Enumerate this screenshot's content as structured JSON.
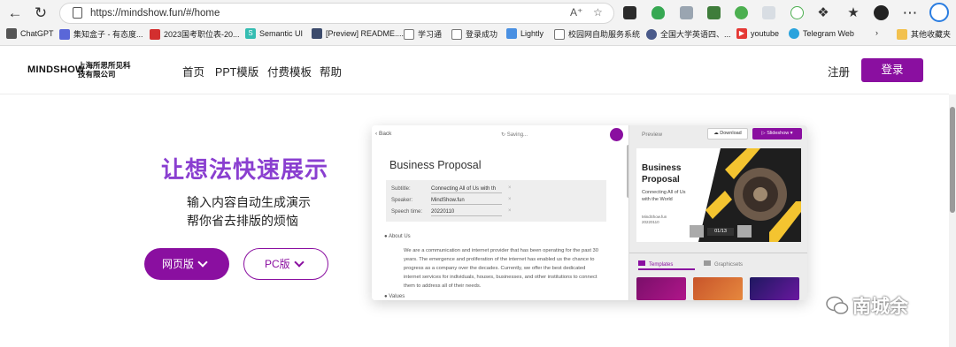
{
  "browser": {
    "url": "https://mindshow.fun/#/home",
    "bookmarks": [
      {
        "label": "ChatGPT",
        "icon": "chatgpt-icon",
        "color": "#555555"
      },
      {
        "label": "集知盒子 - 有态度...",
        "icon": "puzzle-icon",
        "color": "#5a67d8"
      },
      {
        "label": "2023国考职位表-20...",
        "icon": "pdf-icon",
        "color": "#d32f2f"
      },
      {
        "label": "Semantic UI",
        "icon": "semantic-icon",
        "color": "#35bdb2"
      },
      {
        "label": "[Preview] README....",
        "icon": "github-icon",
        "color": "#3c4b6c"
      },
      {
        "label": "学习通",
        "icon": "page-icon",
        "color": "#777777"
      },
      {
        "label": "登录成功",
        "icon": "page-icon",
        "color": "#777777"
      },
      {
        "label": "Lightly",
        "icon": "lightly-icon",
        "color": "#4a90e2"
      },
      {
        "label": "校园网自助服务系统",
        "icon": "page-icon",
        "color": "#777777"
      },
      {
        "label": "全国大学英语四、...",
        "icon": "globe-icon",
        "color": "#4a5a8a"
      },
      {
        "label": "youtube",
        "icon": "youtube-icon",
        "color": "#e53935"
      },
      {
        "label": "Telegram Web",
        "icon": "telegram-icon",
        "color": "#2aa3dd"
      }
    ],
    "other_bookmarks": "其他收藏夹"
  },
  "site": {
    "logo": "MINDSHOW",
    "logo_company": "上海所思所见科技有限公司",
    "nav": [
      "首页",
      "PPT模版",
      "付费模板",
      "帮助"
    ],
    "register": "注册",
    "login": "登录",
    "accent": "#8a0fa0"
  },
  "hero": {
    "title": "让想法快速展示",
    "line1": "输入内容自动生成演示",
    "line2": "帮你省去排版的烦恼",
    "btn_web": "网页版",
    "btn_pc": "PC版"
  },
  "app": {
    "back": "Back",
    "saving": "Saving...",
    "preview": "Preview",
    "download": "Download",
    "slideshow": "Slideshow",
    "doc_title": "Business Proposal",
    "fields": [
      {
        "label": "Subtitle:",
        "value": "Connecting All of Us with th"
      },
      {
        "label": "Speaker:",
        "value": "MindShow.fun"
      },
      {
        "label": "Speech time:",
        "value": "20220110"
      }
    ],
    "section1": "About Us",
    "paragraph": "We are a communication and internet provider that has been operating for the past 30 years. The emergence and proliferation of the internet has enabled us the chance to progress as a company over the decades. Currently, we offer the best dedicated internet services for individuals, houses, businesses, and other institutions to connect them to address all of their needs.",
    "section2": "Values",
    "slide_title_1": "Business",
    "slide_title_2": "Proposal",
    "slide_sub_1": "Connecting All of Us",
    "slide_sub_2": "with the World",
    "slide_meta_1": "MindShow.fun",
    "slide_meta_2": "20220110",
    "page_counter": "01/13",
    "tab_templates": "Templates",
    "tab_graphicsets": "Graphicsets"
  },
  "watermark": "南城余"
}
